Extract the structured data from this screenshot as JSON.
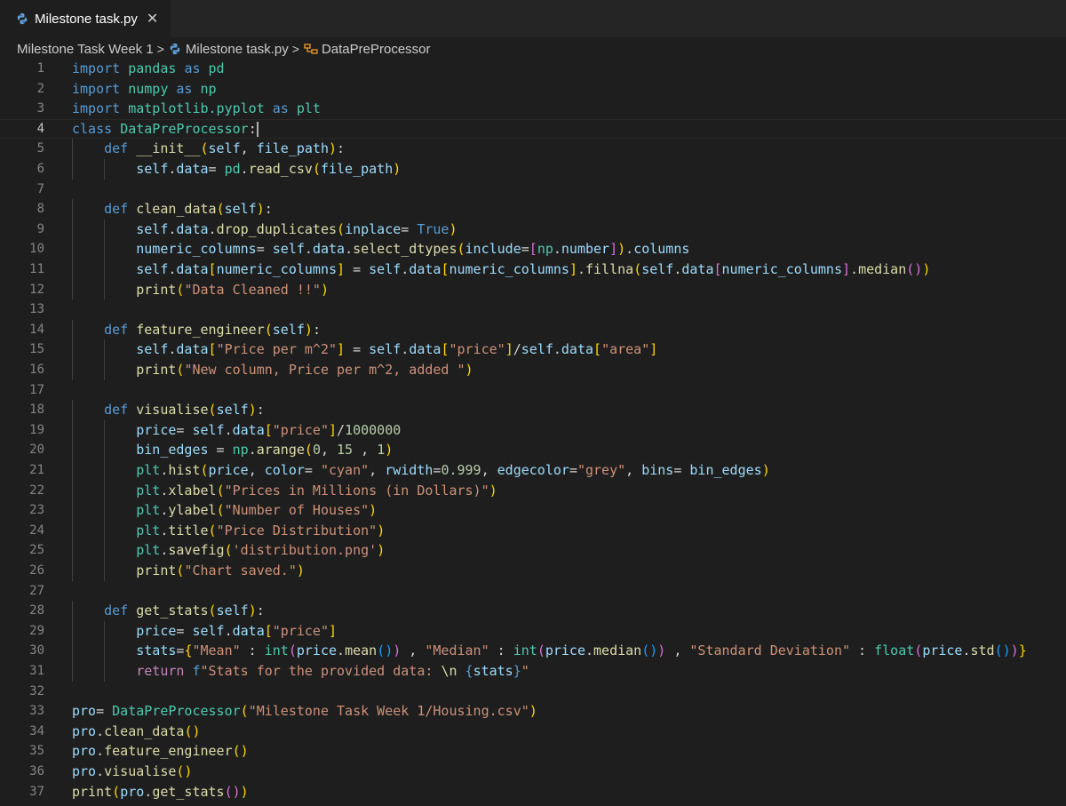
{
  "tab": {
    "filename": "Milestone task.py",
    "close_glyph": "✕"
  },
  "breadcrumb": {
    "folder": "Milestone Task Week 1",
    "file": "Milestone task.py",
    "symbol": "DataPreProcessor"
  },
  "editor": {
    "current_line": 4,
    "lines": [
      [
        [
          "kw",
          "import"
        ],
        [
          "p",
          " "
        ],
        [
          "cls",
          "pandas"
        ],
        [
          "p",
          " "
        ],
        [
          "kw",
          "as"
        ],
        [
          "p",
          " "
        ],
        [
          "cls",
          "pd"
        ]
      ],
      [
        [
          "kw",
          "import"
        ],
        [
          "p",
          " "
        ],
        [
          "cls",
          "numpy"
        ],
        [
          "p",
          " "
        ],
        [
          "kw",
          "as"
        ],
        [
          "p",
          " "
        ],
        [
          "cls",
          "np"
        ]
      ],
      [
        [
          "kw",
          "import"
        ],
        [
          "p",
          " "
        ],
        [
          "cls",
          "matplotlib.pyplot"
        ],
        [
          "p",
          " "
        ],
        [
          "kw",
          "as"
        ],
        [
          "p",
          " "
        ],
        [
          "cls",
          "plt"
        ]
      ],
      [
        [
          "kw",
          "class"
        ],
        [
          "p",
          " "
        ],
        [
          "cls",
          "DataPreProcessor"
        ],
        [
          "p",
          ":"
        ]
      ],
      [
        [
          "p",
          "    "
        ],
        [
          "kw",
          "def"
        ],
        [
          "p",
          " "
        ],
        [
          "fn",
          "__init__"
        ],
        [
          "pr1",
          "("
        ],
        [
          "sf",
          "self"
        ],
        [
          "p",
          ", "
        ],
        [
          "v",
          "file_path"
        ],
        [
          "pr1",
          ")"
        ],
        [
          "p",
          ":"
        ]
      ],
      [
        [
          "p",
          "        "
        ],
        [
          "sf",
          "self"
        ],
        [
          "p",
          "."
        ],
        [
          "v",
          "data"
        ],
        [
          "p",
          "= "
        ],
        [
          "cls",
          "pd"
        ],
        [
          "p",
          "."
        ],
        [
          "fn",
          "read_csv"
        ],
        [
          "pr1",
          "("
        ],
        [
          "v",
          "file_path"
        ],
        [
          "pr1",
          ")"
        ]
      ],
      [
        [
          "p",
          ""
        ]
      ],
      [
        [
          "p",
          "    "
        ],
        [
          "kw",
          "def"
        ],
        [
          "p",
          " "
        ],
        [
          "fn",
          "clean_data"
        ],
        [
          "pr1",
          "("
        ],
        [
          "sf",
          "self"
        ],
        [
          "pr1",
          ")"
        ],
        [
          "p",
          ":"
        ]
      ],
      [
        [
          "p",
          "        "
        ],
        [
          "sf",
          "self"
        ],
        [
          "p",
          "."
        ],
        [
          "v",
          "data"
        ],
        [
          "p",
          "."
        ],
        [
          "fn",
          "drop_duplicates"
        ],
        [
          "pr1",
          "("
        ],
        [
          "v",
          "inplace"
        ],
        [
          "p",
          "= "
        ],
        [
          "kw",
          "True"
        ],
        [
          "pr1",
          ")"
        ]
      ],
      [
        [
          "p",
          "        "
        ],
        [
          "v",
          "numeric_columns"
        ],
        [
          "p",
          "= "
        ],
        [
          "sf",
          "self"
        ],
        [
          "p",
          "."
        ],
        [
          "v",
          "data"
        ],
        [
          "p",
          "."
        ],
        [
          "fn",
          "select_dtypes"
        ],
        [
          "pr1",
          "("
        ],
        [
          "v",
          "include"
        ],
        [
          "p",
          "="
        ],
        [
          "pr2",
          "["
        ],
        [
          "cls",
          "np"
        ],
        [
          "p",
          "."
        ],
        [
          "v",
          "number"
        ],
        [
          "pr2",
          "]"
        ],
        [
          "pr1",
          ")"
        ],
        [
          "p",
          "."
        ],
        [
          "v",
          "columns"
        ]
      ],
      [
        [
          "p",
          "        "
        ],
        [
          "sf",
          "self"
        ],
        [
          "p",
          "."
        ],
        [
          "v",
          "data"
        ],
        [
          "pr1",
          "["
        ],
        [
          "v",
          "numeric_columns"
        ],
        [
          "pr1",
          "]"
        ],
        [
          "p",
          " = "
        ],
        [
          "sf",
          "self"
        ],
        [
          "p",
          "."
        ],
        [
          "v",
          "data"
        ],
        [
          "pr1",
          "["
        ],
        [
          "v",
          "numeric_columns"
        ],
        [
          "pr1",
          "]"
        ],
        [
          "p",
          "."
        ],
        [
          "fn",
          "fillna"
        ],
        [
          "pr1",
          "("
        ],
        [
          "sf",
          "self"
        ],
        [
          "p",
          "."
        ],
        [
          "v",
          "data"
        ],
        [
          "pr2",
          "["
        ],
        [
          "v",
          "numeric_columns"
        ],
        [
          "pr2",
          "]"
        ],
        [
          "p",
          "."
        ],
        [
          "fn",
          "median"
        ],
        [
          "pr2",
          "()"
        ],
        [
          "pr1",
          ")"
        ]
      ],
      [
        [
          "p",
          "        "
        ],
        [
          "fn",
          "print"
        ],
        [
          "pr1",
          "("
        ],
        [
          "s",
          "\"Data Cleaned !!\""
        ],
        [
          "pr1",
          ")"
        ]
      ],
      [
        [
          "p",
          ""
        ]
      ],
      [
        [
          "p",
          "    "
        ],
        [
          "kw",
          "def"
        ],
        [
          "p",
          " "
        ],
        [
          "fn",
          "feature_engineer"
        ],
        [
          "pr1",
          "("
        ],
        [
          "sf",
          "self"
        ],
        [
          "pr1",
          ")"
        ],
        [
          "p",
          ":"
        ]
      ],
      [
        [
          "p",
          "        "
        ],
        [
          "sf",
          "self"
        ],
        [
          "p",
          "."
        ],
        [
          "v",
          "data"
        ],
        [
          "pr1",
          "["
        ],
        [
          "s",
          "\"Price per m^2\""
        ],
        [
          "pr1",
          "]"
        ],
        [
          "p",
          " = "
        ],
        [
          "sf",
          "self"
        ],
        [
          "p",
          "."
        ],
        [
          "v",
          "data"
        ],
        [
          "pr1",
          "["
        ],
        [
          "s",
          "\"price\""
        ],
        [
          "pr1",
          "]"
        ],
        [
          "p",
          "/"
        ],
        [
          "sf",
          "self"
        ],
        [
          "p",
          "."
        ],
        [
          "v",
          "data"
        ],
        [
          "pr1",
          "["
        ],
        [
          "s",
          "\"area\""
        ],
        [
          "pr1",
          "]"
        ]
      ],
      [
        [
          "p",
          "        "
        ],
        [
          "fn",
          "print"
        ],
        [
          "pr1",
          "("
        ],
        [
          "s",
          "\"New column, Price per m^2, added \""
        ],
        [
          "pr1",
          ")"
        ]
      ],
      [
        [
          "p",
          ""
        ]
      ],
      [
        [
          "p",
          "    "
        ],
        [
          "kw",
          "def"
        ],
        [
          "p",
          " "
        ],
        [
          "fn",
          "visualise"
        ],
        [
          "pr1",
          "("
        ],
        [
          "sf",
          "self"
        ],
        [
          "pr1",
          ")"
        ],
        [
          "p",
          ":"
        ]
      ],
      [
        [
          "p",
          "        "
        ],
        [
          "v",
          "price"
        ],
        [
          "p",
          "= "
        ],
        [
          "sf",
          "self"
        ],
        [
          "p",
          "."
        ],
        [
          "v",
          "data"
        ],
        [
          "pr1",
          "["
        ],
        [
          "s",
          "\"price\""
        ],
        [
          "pr1",
          "]"
        ],
        [
          "p",
          "/"
        ],
        [
          "n",
          "1000000"
        ]
      ],
      [
        [
          "p",
          "        "
        ],
        [
          "v",
          "bin_edges"
        ],
        [
          "p",
          " = "
        ],
        [
          "cls",
          "np"
        ],
        [
          "p",
          "."
        ],
        [
          "fn",
          "arange"
        ],
        [
          "pr1",
          "("
        ],
        [
          "n",
          "0"
        ],
        [
          "p",
          ", "
        ],
        [
          "n",
          "15"
        ],
        [
          "p",
          " , "
        ],
        [
          "n",
          "1"
        ],
        [
          "pr1",
          ")"
        ]
      ],
      [
        [
          "p",
          "        "
        ],
        [
          "cls",
          "plt"
        ],
        [
          "p",
          "."
        ],
        [
          "fn",
          "hist"
        ],
        [
          "pr1",
          "("
        ],
        [
          "v",
          "price"
        ],
        [
          "p",
          ", "
        ],
        [
          "v",
          "color"
        ],
        [
          "p",
          "= "
        ],
        [
          "s",
          "\"cyan\""
        ],
        [
          "p",
          ", "
        ],
        [
          "v",
          "rwidth"
        ],
        [
          "p",
          "="
        ],
        [
          "n",
          "0.999"
        ],
        [
          "p",
          ", "
        ],
        [
          "v",
          "edgecolor"
        ],
        [
          "p",
          "="
        ],
        [
          "s",
          "\"grey\""
        ],
        [
          "p",
          ", "
        ],
        [
          "v",
          "bins"
        ],
        [
          "p",
          "= "
        ],
        [
          "v",
          "bin_edges"
        ],
        [
          "pr1",
          ")"
        ]
      ],
      [
        [
          "p",
          "        "
        ],
        [
          "cls",
          "plt"
        ],
        [
          "p",
          "."
        ],
        [
          "fn",
          "xlabel"
        ],
        [
          "pr1",
          "("
        ],
        [
          "s",
          "\"Prices in Millions (in Dollars)\""
        ],
        [
          "pr1",
          ")"
        ]
      ],
      [
        [
          "p",
          "        "
        ],
        [
          "cls",
          "plt"
        ],
        [
          "p",
          "."
        ],
        [
          "fn",
          "ylabel"
        ],
        [
          "pr1",
          "("
        ],
        [
          "s",
          "\"Number of Houses\""
        ],
        [
          "pr1",
          ")"
        ]
      ],
      [
        [
          "p",
          "        "
        ],
        [
          "cls",
          "plt"
        ],
        [
          "p",
          "."
        ],
        [
          "fn",
          "title"
        ],
        [
          "pr1",
          "("
        ],
        [
          "s",
          "\"Price Distribution\""
        ],
        [
          "pr1",
          ")"
        ]
      ],
      [
        [
          "p",
          "        "
        ],
        [
          "cls",
          "plt"
        ],
        [
          "p",
          "."
        ],
        [
          "fn",
          "savefig"
        ],
        [
          "pr1",
          "("
        ],
        [
          "s",
          "'distribution.png'"
        ],
        [
          "pr1",
          ")"
        ]
      ],
      [
        [
          "p",
          "        "
        ],
        [
          "fn",
          "print"
        ],
        [
          "pr1",
          "("
        ],
        [
          "s",
          "\"Chart saved.\""
        ],
        [
          "pr1",
          ")"
        ]
      ],
      [
        [
          "p",
          ""
        ]
      ],
      [
        [
          "p",
          "    "
        ],
        [
          "kw",
          "def"
        ],
        [
          "p",
          " "
        ],
        [
          "fn",
          "get_stats"
        ],
        [
          "pr1",
          "("
        ],
        [
          "sf",
          "self"
        ],
        [
          "pr1",
          ")"
        ],
        [
          "p",
          ":"
        ]
      ],
      [
        [
          "p",
          "        "
        ],
        [
          "v",
          "price"
        ],
        [
          "p",
          "= "
        ],
        [
          "sf",
          "self"
        ],
        [
          "p",
          "."
        ],
        [
          "v",
          "data"
        ],
        [
          "pr1",
          "["
        ],
        [
          "s",
          "\"price\""
        ],
        [
          "pr1",
          "]"
        ]
      ],
      [
        [
          "p",
          "        "
        ],
        [
          "v",
          "stats"
        ],
        [
          "p",
          "="
        ],
        [
          "pr1",
          "{"
        ],
        [
          "s",
          "\"Mean\""
        ],
        [
          "p",
          " : "
        ],
        [
          "cls",
          "int"
        ],
        [
          "pr2",
          "("
        ],
        [
          "v",
          "price"
        ],
        [
          "p",
          "."
        ],
        [
          "fn",
          "mean"
        ],
        [
          "pr3",
          "()"
        ],
        [
          "pr2",
          ")"
        ],
        [
          "p",
          " , "
        ],
        [
          "s",
          "\"Median\""
        ],
        [
          "p",
          " : "
        ],
        [
          "cls",
          "int"
        ],
        [
          "pr2",
          "("
        ],
        [
          "v",
          "price"
        ],
        [
          "p",
          "."
        ],
        [
          "fn",
          "median"
        ],
        [
          "pr3",
          "()"
        ],
        [
          "pr2",
          ")"
        ],
        [
          "p",
          " , "
        ],
        [
          "s",
          "\"Standard Deviation\""
        ],
        [
          "p",
          " : "
        ],
        [
          "cls",
          "float"
        ],
        [
          "pr2",
          "("
        ],
        [
          "v",
          "price"
        ],
        [
          "p",
          "."
        ],
        [
          "fn",
          "std"
        ],
        [
          "pr3",
          "()"
        ],
        [
          "pr2",
          ")"
        ],
        [
          "pr1",
          "}"
        ]
      ],
      [
        [
          "p",
          "        "
        ],
        [
          "k",
          "return"
        ],
        [
          "p",
          " "
        ],
        [
          "kw",
          "f"
        ],
        [
          "s",
          "\"Stats for the provided data: "
        ],
        [
          "fn",
          "\\n"
        ],
        [
          "s",
          " "
        ],
        [
          "kw",
          "{"
        ],
        [
          "v",
          "stats"
        ],
        [
          "kw",
          "}"
        ],
        [
          "s",
          "\""
        ]
      ],
      [
        [
          "p",
          ""
        ]
      ],
      [
        [
          "v",
          "pro"
        ],
        [
          "p",
          "= "
        ],
        [
          "cls",
          "DataPreProcessor"
        ],
        [
          "pr1",
          "("
        ],
        [
          "s",
          "\"Milestone Task Week 1/Housing.csv\""
        ],
        [
          "pr1",
          ")"
        ]
      ],
      [
        [
          "v",
          "pro"
        ],
        [
          "p",
          "."
        ],
        [
          "fn",
          "clean_data"
        ],
        [
          "pr1",
          "()"
        ]
      ],
      [
        [
          "v",
          "pro"
        ],
        [
          "p",
          "."
        ],
        [
          "fn",
          "feature_engineer"
        ],
        [
          "pr1",
          "()"
        ]
      ],
      [
        [
          "v",
          "pro"
        ],
        [
          "p",
          "."
        ],
        [
          "fn",
          "visualise"
        ],
        [
          "pr1",
          "()"
        ]
      ],
      [
        [
          "fn",
          "print"
        ],
        [
          "pr1",
          "("
        ],
        [
          "v",
          "pro"
        ],
        [
          "p",
          "."
        ],
        [
          "fn",
          "get_stats"
        ],
        [
          "pr2",
          "()"
        ],
        [
          "pr1",
          ")"
        ]
      ]
    ]
  }
}
